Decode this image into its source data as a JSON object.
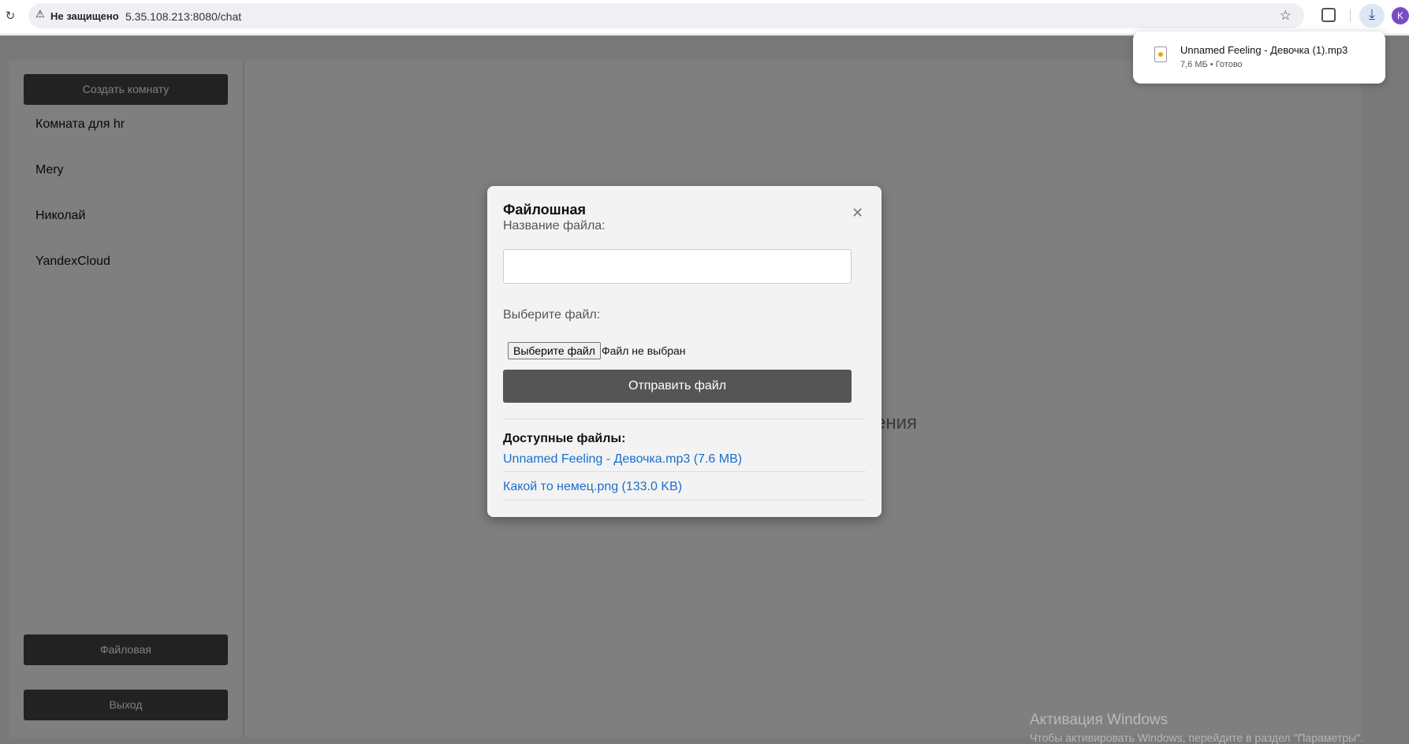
{
  "browser": {
    "not_secure": "Не защищено",
    "url": "5.35.108.213:8080/chat",
    "avatar_letter": "K"
  },
  "sidebar": {
    "create_room": "Создать комнату",
    "rooms": [
      "Комната для hr",
      "Mery",
      "Николай",
      "YandexCloud"
    ],
    "files_button": "Файловая",
    "logout_button": "Выход"
  },
  "main": {
    "placeholder_fragment": "ения"
  },
  "modal": {
    "title": "Файлошная",
    "filename_label": "Название файла:",
    "filename_value": "",
    "choose_label": "Выберите файл:",
    "choose_button": "Выберите файл",
    "no_file": "Файл не выбран",
    "send_button": "Отправить файл",
    "available_heading": "Доступные файлы:",
    "files": [
      "Unnamed Feeling - Девочка.mp3 (7.6 MB)",
      "Какой то немец.png (133.0 KB)"
    ]
  },
  "download_popup": {
    "name": "Unnamed Feeling - Девочка (1).mp3",
    "meta": "7,6 МБ • Готово"
  },
  "watermark": {
    "title": "Активация Windows",
    "subtitle": "Чтобы активировать Windows, перейдите в раздел \"Параметры\"."
  }
}
